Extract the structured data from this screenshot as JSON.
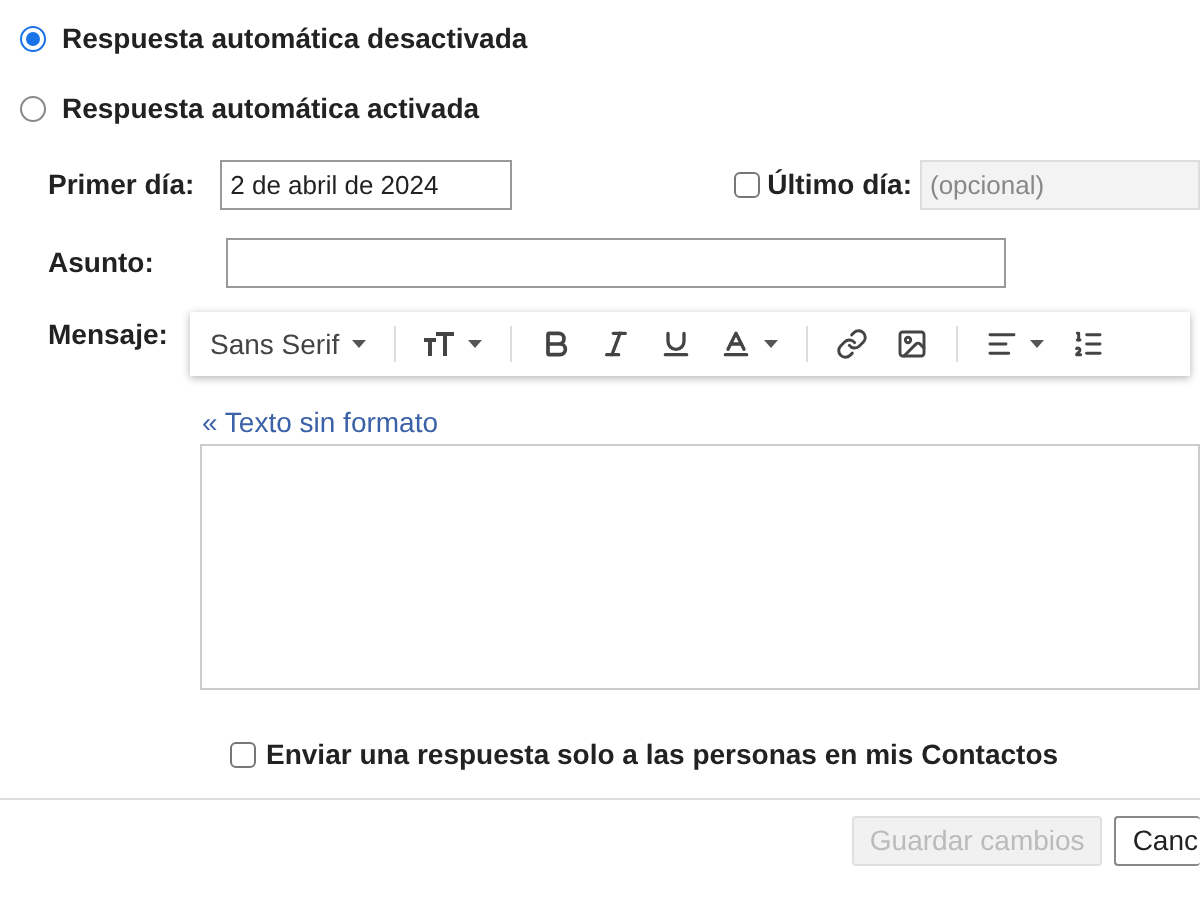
{
  "reply_options": [
    {
      "label": "Respuesta automática desactivada",
      "selected": true
    },
    {
      "label": "Respuesta automática activada",
      "selected": false
    }
  ],
  "first_day": {
    "label": "Primer día:",
    "value": "2 de abril de 2024"
  },
  "last_day": {
    "label": "Último día:",
    "checked": false,
    "placeholder": "(opcional)"
  },
  "subject": {
    "label": "Asunto:"
  },
  "message": {
    "label": "Mensaje:",
    "font": "Sans Serif",
    "plain_text_link": "« Texto sin formato"
  },
  "contacts_only": {
    "label": "Enviar una respuesta solo a las personas en mis Contactos",
    "checked": false
  },
  "buttons": [
    {
      "label": "Guardar cambios",
      "disabled": true
    },
    {
      "label": "Canc",
      "disabled": false
    }
  ]
}
